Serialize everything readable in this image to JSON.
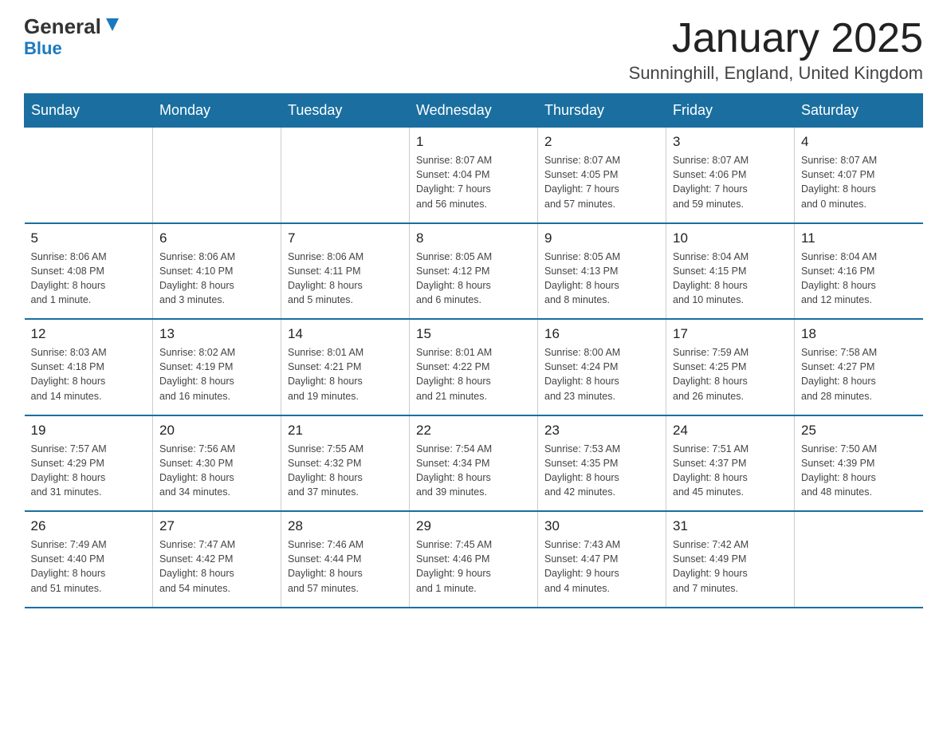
{
  "header": {
    "logo_general": "General",
    "logo_blue": "Blue",
    "month_title": "January 2025",
    "subtitle": "Sunninghill, England, United Kingdom"
  },
  "days_of_week": [
    "Sunday",
    "Monday",
    "Tuesday",
    "Wednesday",
    "Thursday",
    "Friday",
    "Saturday"
  ],
  "weeks": [
    [
      {
        "day": "",
        "info": ""
      },
      {
        "day": "",
        "info": ""
      },
      {
        "day": "",
        "info": ""
      },
      {
        "day": "1",
        "info": "Sunrise: 8:07 AM\nSunset: 4:04 PM\nDaylight: 7 hours\nand 56 minutes."
      },
      {
        "day": "2",
        "info": "Sunrise: 8:07 AM\nSunset: 4:05 PM\nDaylight: 7 hours\nand 57 minutes."
      },
      {
        "day": "3",
        "info": "Sunrise: 8:07 AM\nSunset: 4:06 PM\nDaylight: 7 hours\nand 59 minutes."
      },
      {
        "day": "4",
        "info": "Sunrise: 8:07 AM\nSunset: 4:07 PM\nDaylight: 8 hours\nand 0 minutes."
      }
    ],
    [
      {
        "day": "5",
        "info": "Sunrise: 8:06 AM\nSunset: 4:08 PM\nDaylight: 8 hours\nand 1 minute."
      },
      {
        "day": "6",
        "info": "Sunrise: 8:06 AM\nSunset: 4:10 PM\nDaylight: 8 hours\nand 3 minutes."
      },
      {
        "day": "7",
        "info": "Sunrise: 8:06 AM\nSunset: 4:11 PM\nDaylight: 8 hours\nand 5 minutes."
      },
      {
        "day": "8",
        "info": "Sunrise: 8:05 AM\nSunset: 4:12 PM\nDaylight: 8 hours\nand 6 minutes."
      },
      {
        "day": "9",
        "info": "Sunrise: 8:05 AM\nSunset: 4:13 PM\nDaylight: 8 hours\nand 8 minutes."
      },
      {
        "day": "10",
        "info": "Sunrise: 8:04 AM\nSunset: 4:15 PM\nDaylight: 8 hours\nand 10 minutes."
      },
      {
        "day": "11",
        "info": "Sunrise: 8:04 AM\nSunset: 4:16 PM\nDaylight: 8 hours\nand 12 minutes."
      }
    ],
    [
      {
        "day": "12",
        "info": "Sunrise: 8:03 AM\nSunset: 4:18 PM\nDaylight: 8 hours\nand 14 minutes."
      },
      {
        "day": "13",
        "info": "Sunrise: 8:02 AM\nSunset: 4:19 PM\nDaylight: 8 hours\nand 16 minutes."
      },
      {
        "day": "14",
        "info": "Sunrise: 8:01 AM\nSunset: 4:21 PM\nDaylight: 8 hours\nand 19 minutes."
      },
      {
        "day": "15",
        "info": "Sunrise: 8:01 AM\nSunset: 4:22 PM\nDaylight: 8 hours\nand 21 minutes."
      },
      {
        "day": "16",
        "info": "Sunrise: 8:00 AM\nSunset: 4:24 PM\nDaylight: 8 hours\nand 23 minutes."
      },
      {
        "day": "17",
        "info": "Sunrise: 7:59 AM\nSunset: 4:25 PM\nDaylight: 8 hours\nand 26 minutes."
      },
      {
        "day": "18",
        "info": "Sunrise: 7:58 AM\nSunset: 4:27 PM\nDaylight: 8 hours\nand 28 minutes."
      }
    ],
    [
      {
        "day": "19",
        "info": "Sunrise: 7:57 AM\nSunset: 4:29 PM\nDaylight: 8 hours\nand 31 minutes."
      },
      {
        "day": "20",
        "info": "Sunrise: 7:56 AM\nSunset: 4:30 PM\nDaylight: 8 hours\nand 34 minutes."
      },
      {
        "day": "21",
        "info": "Sunrise: 7:55 AM\nSunset: 4:32 PM\nDaylight: 8 hours\nand 37 minutes."
      },
      {
        "day": "22",
        "info": "Sunrise: 7:54 AM\nSunset: 4:34 PM\nDaylight: 8 hours\nand 39 minutes."
      },
      {
        "day": "23",
        "info": "Sunrise: 7:53 AM\nSunset: 4:35 PM\nDaylight: 8 hours\nand 42 minutes."
      },
      {
        "day": "24",
        "info": "Sunrise: 7:51 AM\nSunset: 4:37 PM\nDaylight: 8 hours\nand 45 minutes."
      },
      {
        "day": "25",
        "info": "Sunrise: 7:50 AM\nSunset: 4:39 PM\nDaylight: 8 hours\nand 48 minutes."
      }
    ],
    [
      {
        "day": "26",
        "info": "Sunrise: 7:49 AM\nSunset: 4:40 PM\nDaylight: 8 hours\nand 51 minutes."
      },
      {
        "day": "27",
        "info": "Sunrise: 7:47 AM\nSunset: 4:42 PM\nDaylight: 8 hours\nand 54 minutes."
      },
      {
        "day": "28",
        "info": "Sunrise: 7:46 AM\nSunset: 4:44 PM\nDaylight: 8 hours\nand 57 minutes."
      },
      {
        "day": "29",
        "info": "Sunrise: 7:45 AM\nSunset: 4:46 PM\nDaylight: 9 hours\nand 1 minute."
      },
      {
        "day": "30",
        "info": "Sunrise: 7:43 AM\nSunset: 4:47 PM\nDaylight: 9 hours\nand 4 minutes."
      },
      {
        "day": "31",
        "info": "Sunrise: 7:42 AM\nSunset: 4:49 PM\nDaylight: 9 hours\nand 7 minutes."
      },
      {
        "day": "",
        "info": ""
      }
    ]
  ]
}
